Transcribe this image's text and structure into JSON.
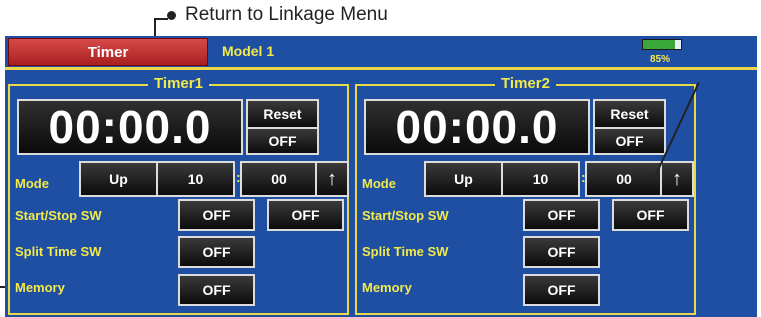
{
  "annotation": {
    "text": "Return to Linkage Menu"
  },
  "header": {
    "title": "Timer",
    "model": "Model 1",
    "battery_percent": "85%",
    "battery_level": 0.85
  },
  "timers": [
    {
      "title": "Timer1",
      "display": "00:00.0",
      "reset_label": "Reset",
      "reset_state": "OFF",
      "mode_label": "Mode",
      "mode": "Up",
      "minutes": "10",
      "seconds": "00",
      "arrow": "↑",
      "startstop_label": "Start/Stop SW",
      "startstop_sw1": "OFF",
      "startstop_sw2": "OFF",
      "split_label": "Split Time SW",
      "split_sw": "OFF",
      "memory_label": "Memory",
      "memory": "OFF"
    },
    {
      "title": "Timer2",
      "display": "00:00.0",
      "reset_label": "Reset",
      "reset_state": "OFF",
      "mode_label": "Mode",
      "mode": "Up",
      "minutes": "10",
      "seconds": "00",
      "arrow": "↑",
      "startstop_label": "Start/Stop SW",
      "startstop_sw1": "OFF",
      "startstop_sw2": "OFF",
      "split_label": "Split Time SW",
      "split_sw": "OFF",
      "memory_label": "Memory",
      "memory": "OFF"
    }
  ],
  "colors": {
    "screen_bg": "#1e4fa3",
    "label_yellow": "#f2e94a",
    "title_red": "#b52a2a",
    "battery_green": "#3aa93a"
  }
}
